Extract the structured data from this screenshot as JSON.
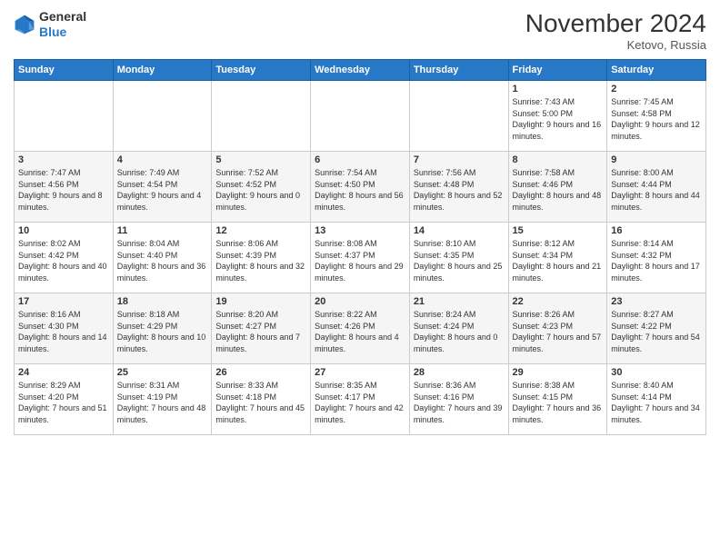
{
  "logo": {
    "general": "General",
    "blue": "Blue"
  },
  "title": "November 2024",
  "location": "Ketovo, Russia",
  "weekdays": [
    "Sunday",
    "Monday",
    "Tuesday",
    "Wednesday",
    "Thursday",
    "Friday",
    "Saturday"
  ],
  "weeks": [
    [
      {
        "day": "",
        "info": ""
      },
      {
        "day": "",
        "info": ""
      },
      {
        "day": "",
        "info": ""
      },
      {
        "day": "",
        "info": ""
      },
      {
        "day": "",
        "info": ""
      },
      {
        "day": "1",
        "info": "Sunrise: 7:43 AM\nSunset: 5:00 PM\nDaylight: 9 hours and 16 minutes."
      },
      {
        "day": "2",
        "info": "Sunrise: 7:45 AM\nSunset: 4:58 PM\nDaylight: 9 hours and 12 minutes."
      }
    ],
    [
      {
        "day": "3",
        "info": "Sunrise: 7:47 AM\nSunset: 4:56 PM\nDaylight: 9 hours and 8 minutes."
      },
      {
        "day": "4",
        "info": "Sunrise: 7:49 AM\nSunset: 4:54 PM\nDaylight: 9 hours and 4 minutes."
      },
      {
        "day": "5",
        "info": "Sunrise: 7:52 AM\nSunset: 4:52 PM\nDaylight: 9 hours and 0 minutes."
      },
      {
        "day": "6",
        "info": "Sunrise: 7:54 AM\nSunset: 4:50 PM\nDaylight: 8 hours and 56 minutes."
      },
      {
        "day": "7",
        "info": "Sunrise: 7:56 AM\nSunset: 4:48 PM\nDaylight: 8 hours and 52 minutes."
      },
      {
        "day": "8",
        "info": "Sunrise: 7:58 AM\nSunset: 4:46 PM\nDaylight: 8 hours and 48 minutes."
      },
      {
        "day": "9",
        "info": "Sunrise: 8:00 AM\nSunset: 4:44 PM\nDaylight: 8 hours and 44 minutes."
      }
    ],
    [
      {
        "day": "10",
        "info": "Sunrise: 8:02 AM\nSunset: 4:42 PM\nDaylight: 8 hours and 40 minutes."
      },
      {
        "day": "11",
        "info": "Sunrise: 8:04 AM\nSunset: 4:40 PM\nDaylight: 8 hours and 36 minutes."
      },
      {
        "day": "12",
        "info": "Sunrise: 8:06 AM\nSunset: 4:39 PM\nDaylight: 8 hours and 32 minutes."
      },
      {
        "day": "13",
        "info": "Sunrise: 8:08 AM\nSunset: 4:37 PM\nDaylight: 8 hours and 29 minutes."
      },
      {
        "day": "14",
        "info": "Sunrise: 8:10 AM\nSunset: 4:35 PM\nDaylight: 8 hours and 25 minutes."
      },
      {
        "day": "15",
        "info": "Sunrise: 8:12 AM\nSunset: 4:34 PM\nDaylight: 8 hours and 21 minutes."
      },
      {
        "day": "16",
        "info": "Sunrise: 8:14 AM\nSunset: 4:32 PM\nDaylight: 8 hours and 17 minutes."
      }
    ],
    [
      {
        "day": "17",
        "info": "Sunrise: 8:16 AM\nSunset: 4:30 PM\nDaylight: 8 hours and 14 minutes."
      },
      {
        "day": "18",
        "info": "Sunrise: 8:18 AM\nSunset: 4:29 PM\nDaylight: 8 hours and 10 minutes."
      },
      {
        "day": "19",
        "info": "Sunrise: 8:20 AM\nSunset: 4:27 PM\nDaylight: 8 hours and 7 minutes."
      },
      {
        "day": "20",
        "info": "Sunrise: 8:22 AM\nSunset: 4:26 PM\nDaylight: 8 hours and 4 minutes."
      },
      {
        "day": "21",
        "info": "Sunrise: 8:24 AM\nSunset: 4:24 PM\nDaylight: 8 hours and 0 minutes."
      },
      {
        "day": "22",
        "info": "Sunrise: 8:26 AM\nSunset: 4:23 PM\nDaylight: 7 hours and 57 minutes."
      },
      {
        "day": "23",
        "info": "Sunrise: 8:27 AM\nSunset: 4:22 PM\nDaylight: 7 hours and 54 minutes."
      }
    ],
    [
      {
        "day": "24",
        "info": "Sunrise: 8:29 AM\nSunset: 4:20 PM\nDaylight: 7 hours and 51 minutes."
      },
      {
        "day": "25",
        "info": "Sunrise: 8:31 AM\nSunset: 4:19 PM\nDaylight: 7 hours and 48 minutes."
      },
      {
        "day": "26",
        "info": "Sunrise: 8:33 AM\nSunset: 4:18 PM\nDaylight: 7 hours and 45 minutes."
      },
      {
        "day": "27",
        "info": "Sunrise: 8:35 AM\nSunset: 4:17 PM\nDaylight: 7 hours and 42 minutes."
      },
      {
        "day": "28",
        "info": "Sunrise: 8:36 AM\nSunset: 4:16 PM\nDaylight: 7 hours and 39 minutes."
      },
      {
        "day": "29",
        "info": "Sunrise: 8:38 AM\nSunset: 4:15 PM\nDaylight: 7 hours and 36 minutes."
      },
      {
        "day": "30",
        "info": "Sunrise: 8:40 AM\nSunset: 4:14 PM\nDaylight: 7 hours and 34 minutes."
      }
    ]
  ]
}
